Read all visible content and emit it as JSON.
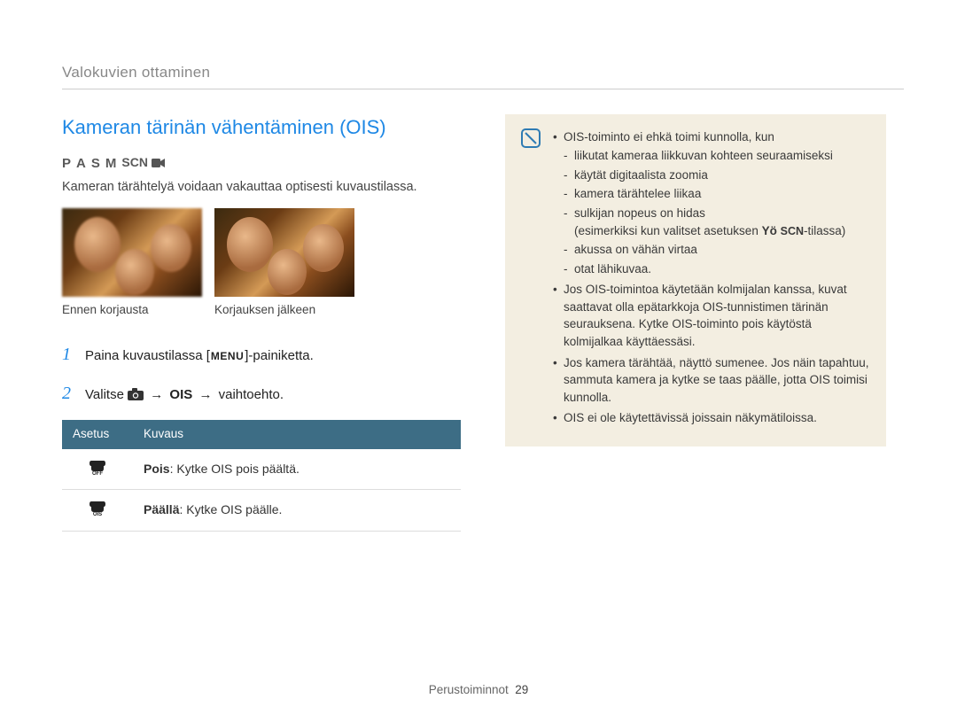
{
  "section": "Valokuvien ottaminen",
  "title": "Kameran tärinän vähentäminen (OIS)",
  "modes": {
    "p": "P",
    "a": "A",
    "s": "S",
    "m": "M",
    "scn": "SCN"
  },
  "intro": "Kameran tärähtelyä voidaan vakauttaa optisesti kuvaustilassa.",
  "caption_before": "Ennen korjausta",
  "caption_after": "Korjauksen jälkeen",
  "steps": {
    "n1": "1",
    "s1_pre": "Paina kuvaustilassa [",
    "s1_menu": "MENU",
    "s1_post": "]-painiketta.",
    "n2": "2",
    "s2_pre": "Valitse ",
    "s2_arrow": "→",
    "s2_ois": "OIS",
    "s2_post": " vaihtoehto."
  },
  "table": {
    "h1": "Asetus",
    "h2": "Kuvaus",
    "r1_bold": "Pois",
    "r1_rest": ": Kytke OIS pois päältä.",
    "r2_bold": "Päällä",
    "r2_rest": ": Kytke OIS päälle."
  },
  "notes": {
    "b1": "OIS-toiminto ei ehkä toimi kunnolla, kun",
    "b1s1": "liikutat kameraa liikkuvan kohteen seuraamiseksi",
    "b1s2": "käytät digitaalista zoomia",
    "b1s3": "kamera tärähtelee liikaa",
    "b1s4_pre": "sulkijan nopeus on hidas",
    "b1s4_paren_pre": "(esimerkiksi kun valitset asetuksen ",
    "b1s4_yo": "Yö",
    "b1s4_scn": "SCN",
    "b1s4_paren_post": "-tilassa)",
    "b1s5": "akussa on vähän virtaa",
    "b1s6": "otat lähikuvaa.",
    "b2": "Jos OIS-toimintoa käytetään kolmijalan kanssa, kuvat saattavat olla epätarkkoja OIS-tunnistimen tärinän seurauksena. Kytke OIS-toiminto pois käytöstä kolmijalkaa käyttäessäsi.",
    "b3": "Jos kamera tärähtää, näyttö sumenee. Jos näin tapahtuu, sammuta kamera ja kytke se taas päälle, jotta OIS toimisi kunnolla.",
    "b4": "OIS ei ole käytettävissä joissain näkymätiloissa."
  },
  "footer": {
    "label": "Perustoiminnot",
    "page": "29"
  }
}
